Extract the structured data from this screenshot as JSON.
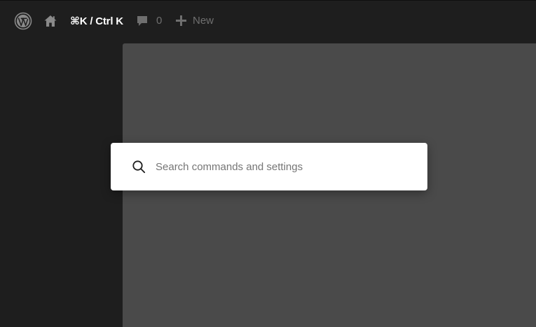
{
  "admin_bar": {
    "shortcut_label": "⌘K / Ctrl K",
    "comments_count": "0",
    "new_label": "New"
  },
  "command_palette": {
    "search_value": "",
    "search_placeholder": "Search commands and settings"
  },
  "colors": {
    "admin_bar_bg": "#1e1e1e",
    "canvas_bg": "#4a4a4a",
    "palette_bg": "#ffffff",
    "muted_text": "#6f6f6f"
  },
  "icons": [
    "wordpress-logo-icon",
    "home-icon",
    "comment-bubble-icon",
    "plus-icon",
    "search-icon"
  ]
}
